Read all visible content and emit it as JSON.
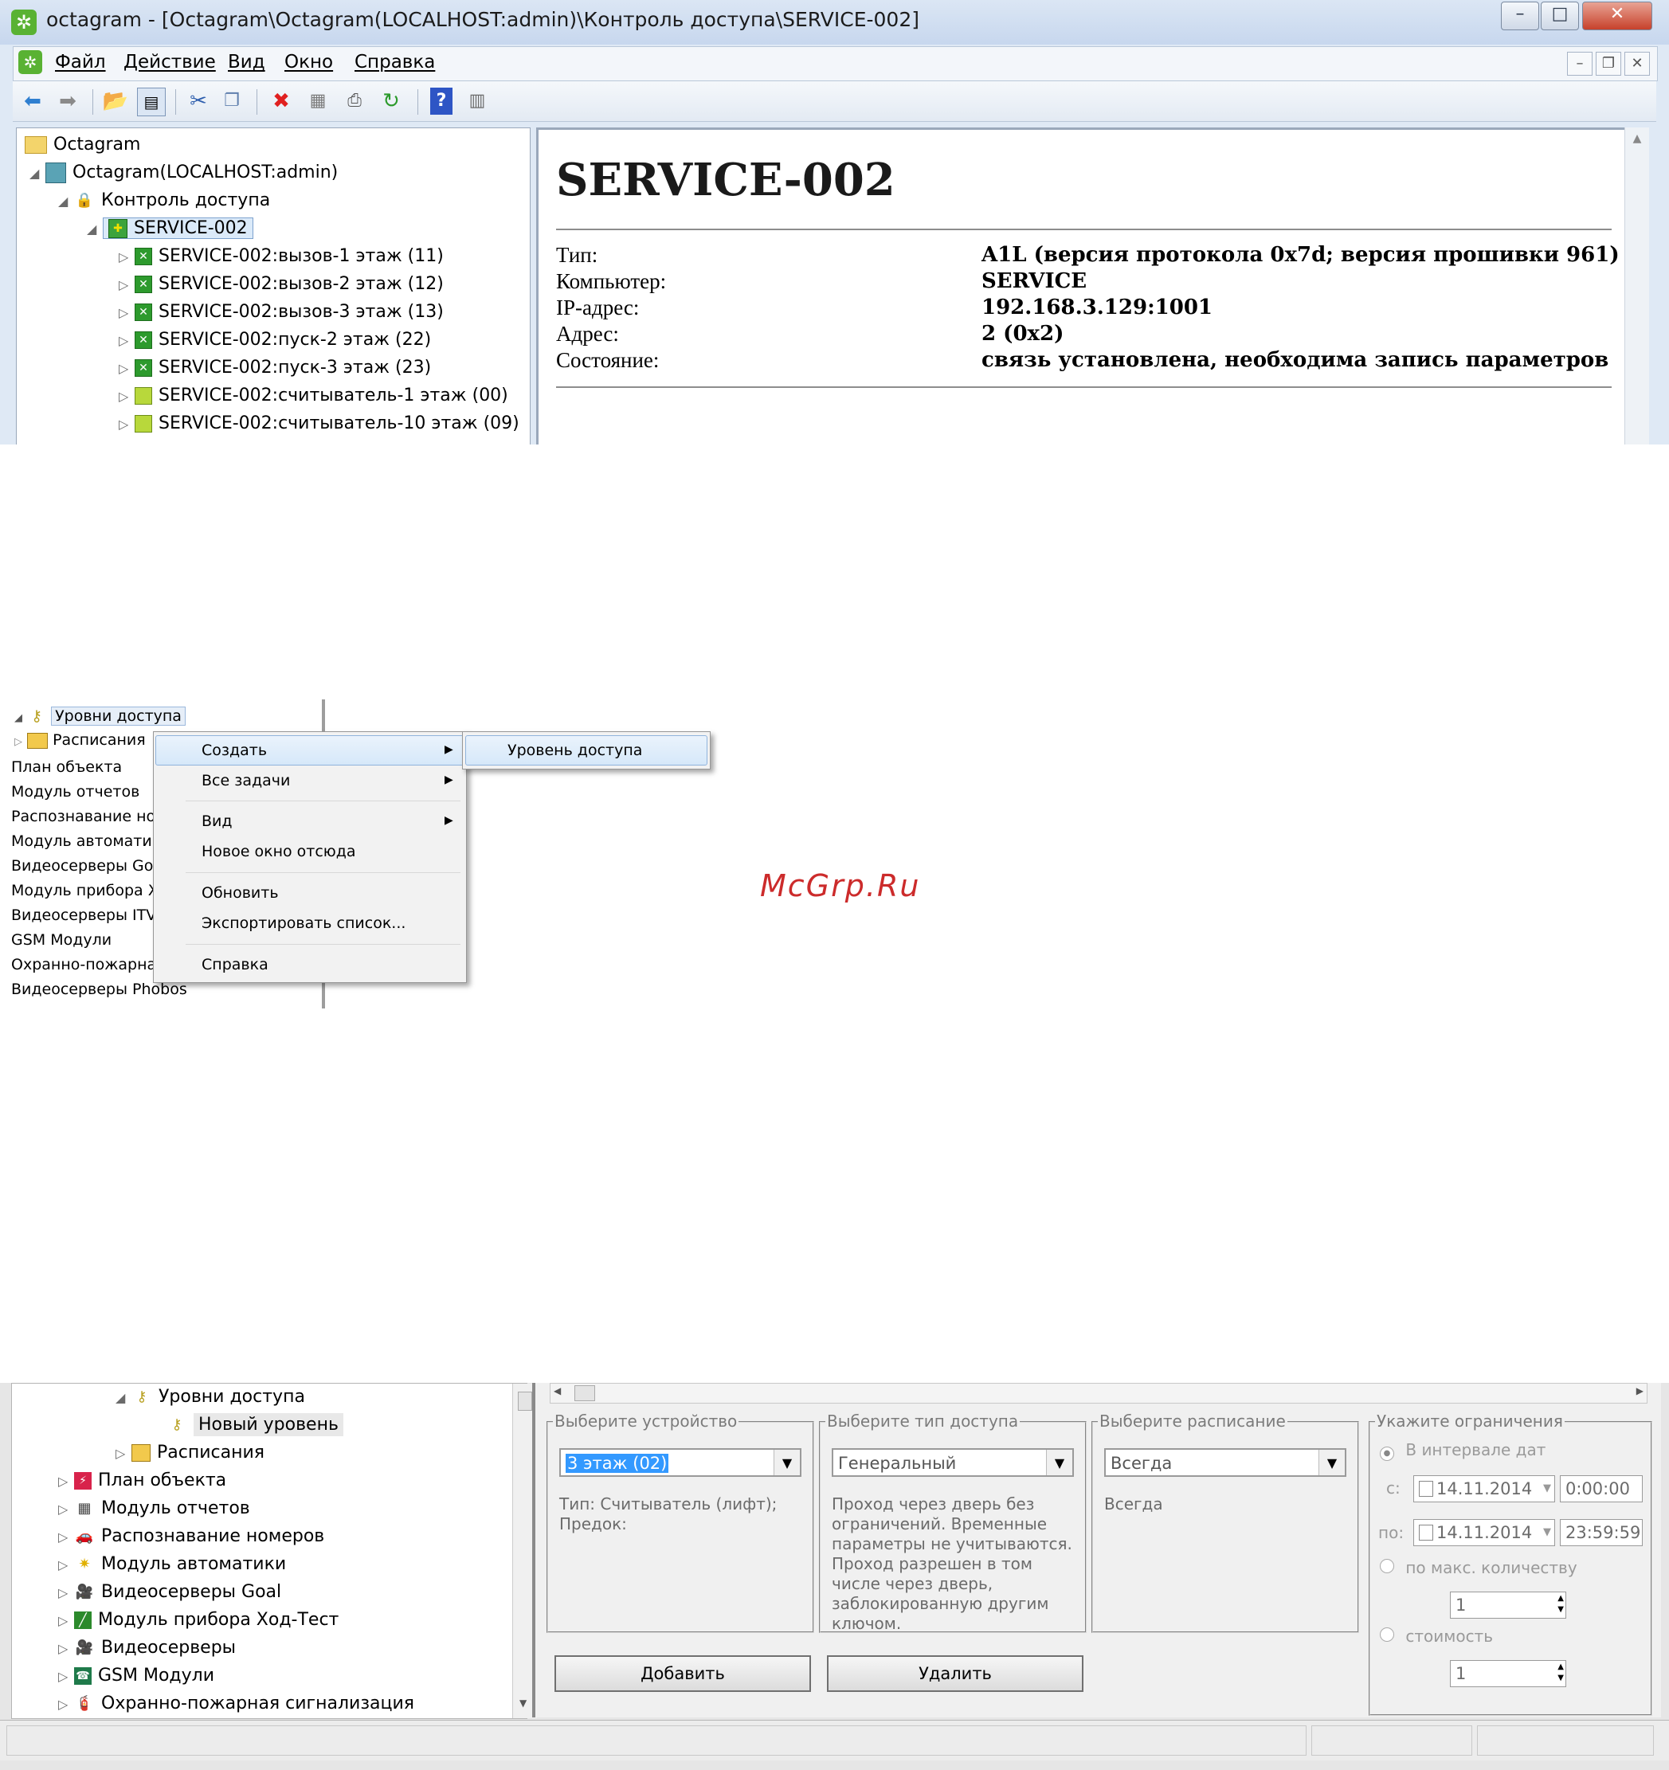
{
  "window": {
    "title": "octagram - [Octagram\\Octagram(LOCALHOST:admin)\\Контроль доступа\\SERVICE-002]",
    "minimize": "–",
    "maximize": "□",
    "close": "✕"
  },
  "menu": {
    "items": [
      "Файл",
      "Действие",
      "Вид",
      "Окно",
      "Справка"
    ],
    "mdi": {
      "min": "–",
      "restore": "❐",
      "close": "✕"
    }
  },
  "toolbar": {
    "icons": [
      "back-icon",
      "forward-icon",
      "up-folder-icon",
      "show-tree-icon",
      "cut-icon",
      "copy-icon",
      "delete-icon",
      "properties-icon",
      "print-icon",
      "refresh-icon",
      "help-icon",
      "view-icon"
    ]
  },
  "tree1": {
    "root": "Octagram",
    "server": "Octagram(LOCALHOST:admin)",
    "access": "Контроль доступа",
    "selected": "SERVICE-002",
    "children": [
      "SERVICE-002:вызов-1 этаж (11)",
      "SERVICE-002:вызов-2 этаж (12)",
      "SERVICE-002:вызов-3 этаж (13)",
      "SERVICE-002:пуск-2 этаж (22)",
      "SERVICE-002:пуск-3 этаж (23)",
      "SERVICE-002:считыватель-1 этаж (00)",
      "SERVICE-002:считыватель-10 этаж (09)"
    ]
  },
  "details": {
    "title": "SERVICE-002",
    "rows": [
      {
        "label": "Тип:",
        "value": "A1L (версия протокола 0x7d; версия прошивки 961)"
      },
      {
        "label": "Компьютер:",
        "value": "SERVICE"
      },
      {
        "label": "IP-адрес:",
        "value": "192.168.3.129:1001"
      },
      {
        "label": "Адрес:",
        "value": "2 (0x2)"
      },
      {
        "label": "Состояние:",
        "value": "связь установлена, необходима запись параметров"
      }
    ]
  },
  "tree2": {
    "levels": "Уровни доступа",
    "schedules": "Расписания",
    "items": [
      "План объекта",
      "Модуль отчетов",
      "Распознавание но",
      "Модуль автоматик",
      "Видеосерверы Goa",
      "Модуль прибора Х",
      "Видеосерверы ITV",
      "GSM Модули",
      "Охранно-пожарна",
      "Видеосерверы Phobos"
    ]
  },
  "context_menu": {
    "items": [
      "Создать",
      "Все задачи",
      "Вид",
      "Новое окно отсюда",
      "Обновить",
      "Экспортировать список...",
      "Справка"
    ],
    "submenu": "Уровень доступа"
  },
  "watermark": "McGrp.Ru",
  "tree3": {
    "levels": "Уровни доступа",
    "new_level": "Новый уровень",
    "schedules": "Расписания",
    "items": [
      "План объекта",
      "Модуль отчетов",
      "Распознавание номеров",
      "Модуль автоматики",
      "Видеосерверы Goal",
      "Модуль прибора Ход-Тест",
      "Видеосерверы",
      "GSM Модули",
      "Охранно-пожарная сигнализация"
    ]
  },
  "editor": {
    "device": {
      "title": "Выберите устройство",
      "value": "3 этаж (02)",
      "info": "Тип: Считыватель (лифт);\nПредок:"
    },
    "access_type": {
      "title": "Выберите тип доступа",
      "value": "Генеральный",
      "info": "Проход через дверь без ограничений. Временные параметры не учитываются. Проход разрешен в том числе через дверь, заблокированную другим ключом."
    },
    "schedule": {
      "title": "Выберите расписание",
      "value": "Всегда",
      "info": "Всегда"
    },
    "limits": {
      "title": "Укажите ограничения",
      "interval_label": "В интервале дат",
      "from_label": "с:",
      "from_date": "14.11.2014",
      "from_time": "0:00:00",
      "to_label": "по:",
      "to_date": "14.11.2014",
      "to_time": "23:59:59",
      "max_count_label": "по макс. количеству",
      "max_count_value": "1",
      "cost_label": "стоимость",
      "cost_value": "1"
    },
    "add_button": "Добавить",
    "delete_button": "Удалить"
  }
}
